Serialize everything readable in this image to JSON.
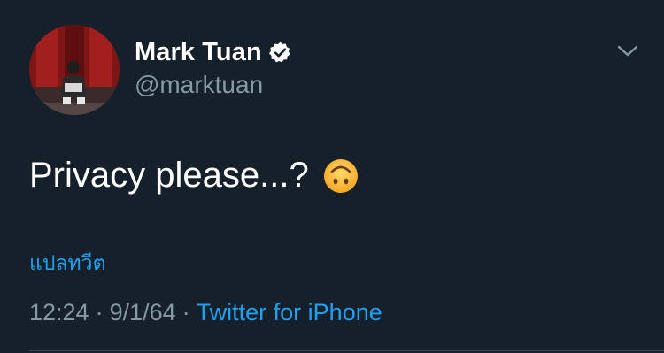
{
  "author": {
    "display_name": "Mark Tuan",
    "handle": "@marktuan",
    "verified": true
  },
  "icons": {
    "verified": "verified-badge-icon",
    "caret": "chevron-down-icon",
    "emoji": "upside-down-face-emoji"
  },
  "tweet": {
    "text": "Privacy please...?",
    "translate_label": "แปลทวีต",
    "time": "12:24",
    "date": "9/1/64",
    "source": "Twitter for iPhone",
    "separator": "·"
  },
  "colors": {
    "background": "#15202b",
    "link": "#1da1f2",
    "secondary_text": "#8899a6"
  }
}
